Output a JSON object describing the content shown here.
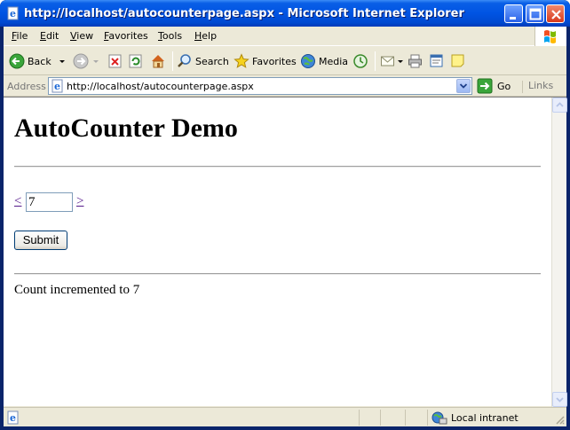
{
  "window": {
    "title": "http://localhost/autocounterpage.aspx - Microsoft Internet Explorer"
  },
  "menu": {
    "items": [
      {
        "label": "File",
        "key": "F",
        "rest": "ile"
      },
      {
        "label": "Edit",
        "key": "E",
        "rest": "dit"
      },
      {
        "label": "View",
        "key": "V",
        "rest": "iew"
      },
      {
        "label": "Favorites",
        "key": "F",
        "rest": "avorites"
      },
      {
        "label": "Tools",
        "key": "T",
        "rest": "ools"
      },
      {
        "label": "Help",
        "key": "H",
        "rest": "elp"
      }
    ]
  },
  "toolbar": {
    "back_label": "Back",
    "search_label": "Search",
    "favorites_label": "Favorites",
    "media_label": "Media"
  },
  "address": {
    "label": "Address",
    "url": "http://localhost/autocounterpage.aspx",
    "go_label": "Go",
    "links_label": "Links"
  },
  "page": {
    "heading": "AutoCounter Demo",
    "prev_link": "<",
    "next_link": ">",
    "counter_value": "7",
    "submit_label": "Submit",
    "message": "Count incremented to 7"
  },
  "status": {
    "zone_label": "Local intranet"
  },
  "colors": {
    "title_bar": "#0054e3",
    "visited_link": "#551a8b",
    "chrome": "#ece9d8"
  }
}
